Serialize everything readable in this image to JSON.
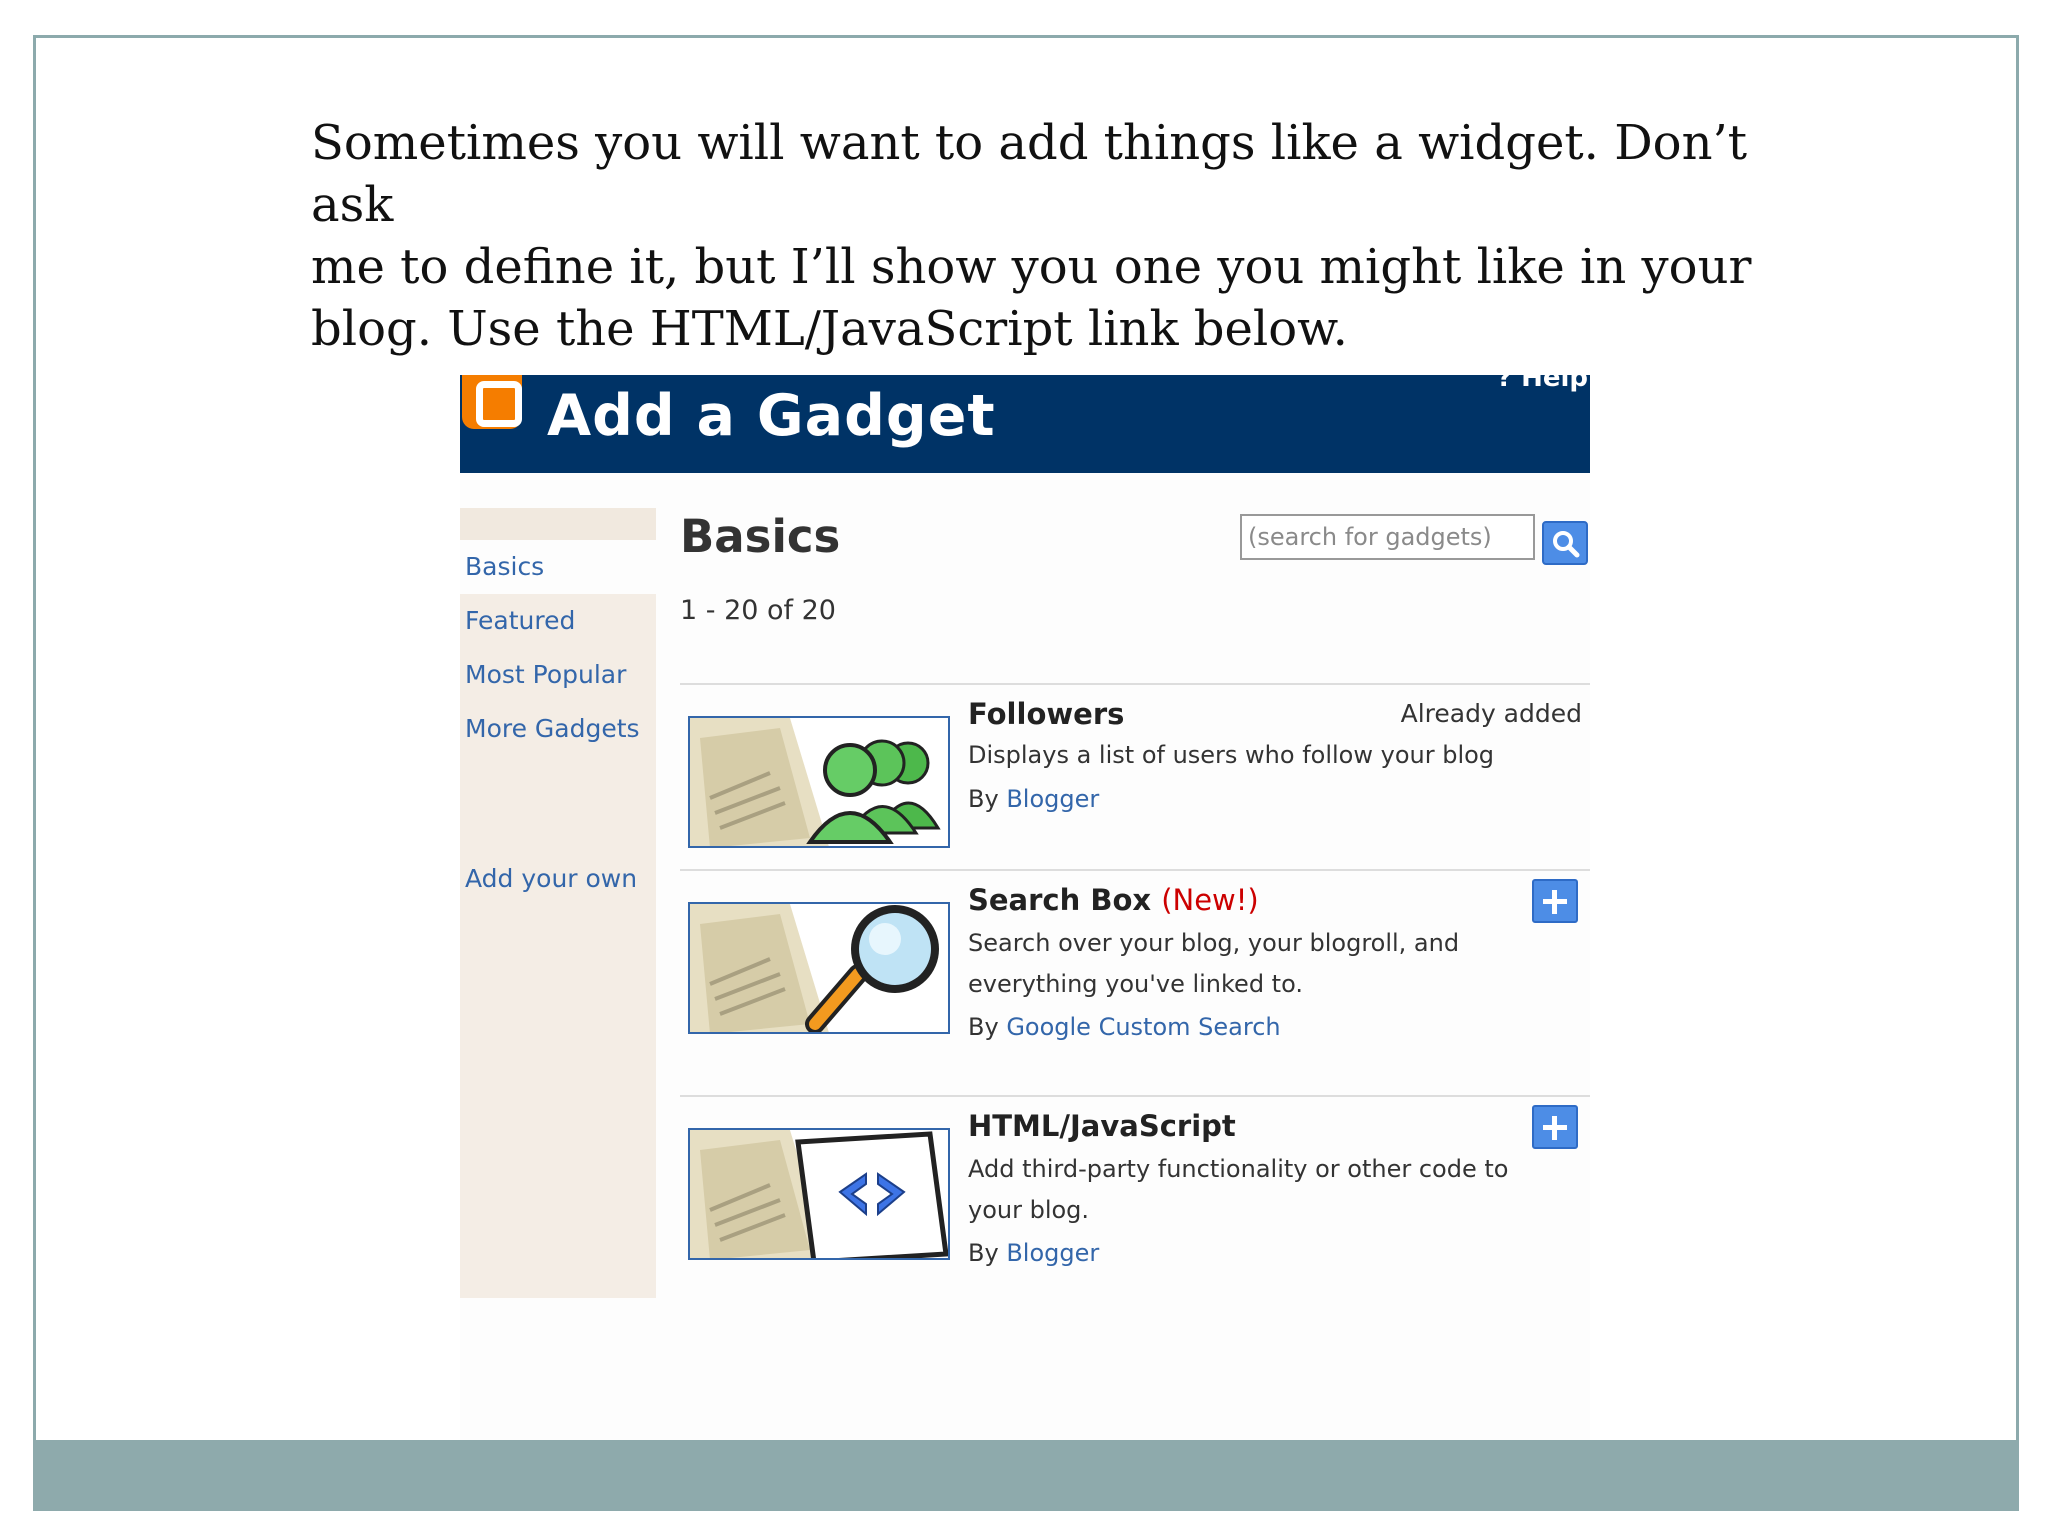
{
  "caption": "Sometimes you will want to add things like a widget.  Don’t ask\nme to define it, but I’ll show you one you might like in your\nblog.  Use the HTML/JavaScript link below.",
  "header": {
    "title": "Add a Gadget",
    "help_label": "? Help"
  },
  "sidebar": {
    "items": [
      {
        "label": "Basics"
      },
      {
        "label": "Featured"
      },
      {
        "label": "Most Popular"
      },
      {
        "label": "More Gadgets"
      }
    ],
    "add_own_label": "Add your own"
  },
  "main": {
    "title": "Basics",
    "search": {
      "placeholder": "(search for gadgets)"
    },
    "range_text": "1 - 20 of 20"
  },
  "gadgets": [
    {
      "name": "Followers",
      "status": "Already added",
      "description": "Displays a list of users who follow your blog",
      "by_prefix": "By",
      "author": "Blogger"
    },
    {
      "name": "Search Box",
      "badge": "(New!)",
      "description": "Search over your blog, your blogroll, and everything you've linked to.",
      "by_prefix": "By",
      "author": "Google Custom Search"
    },
    {
      "name": "HTML/JavaScript",
      "description": "Add third-party functionality or other code to your blog.",
      "by_prefix": "By",
      "author": "Blogger"
    }
  ],
  "colors": {
    "header_bg": "#003366",
    "logo_orange": "#f57d00",
    "link_blue": "#3366aa",
    "new_red": "#cc0000",
    "footer_bar": "#8eaaac"
  }
}
